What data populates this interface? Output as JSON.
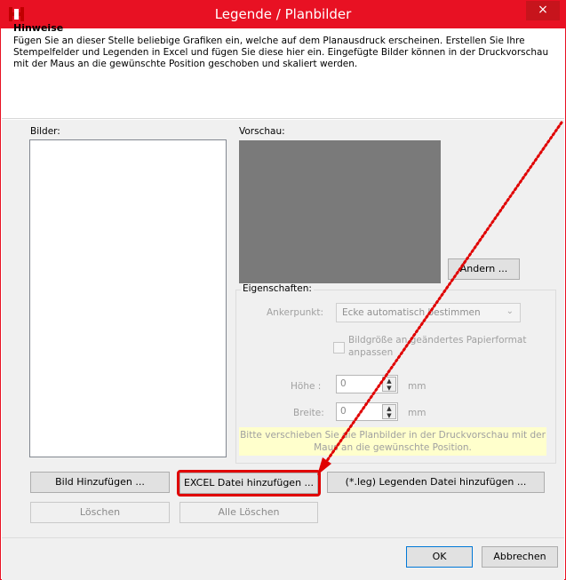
{
  "window": {
    "title": "Legende / Planbilder",
    "close_glyph": "×",
    "accent": "#e81123"
  },
  "hints": {
    "title": "Hinweise",
    "text": "Fügen Sie an dieser Stelle beliebige Grafiken ein, welche auf dem Planausdruck erscheinen.  Erstellen Sie Ihre Stempelfelder und Legenden in Excel und fügen Sie diese hier ein.  Eingefügte Bilder können in der Druckvorschau mit der Maus an die gewünschte Position geschoben und skaliert werden."
  },
  "images": {
    "label": "Bilder:",
    "items": []
  },
  "preview": {
    "label": "Vorschau:",
    "change_button": "Ändern ..."
  },
  "properties": {
    "title": "Eigenschaften:",
    "anchor_label": "Ankerpunkt:",
    "anchor_value": "Ecke automatisch bestimmen",
    "resize_label": "Bildgröße an geändertes Papierformat anpassen",
    "resize_checked": false,
    "height_label": "Höhe :",
    "height_value": "0",
    "width_label": "Breite:",
    "width_value": "0",
    "unit": "mm",
    "info": "Bitte verschieben Sie die Planbilder in der Druckvorschau mit der Maus an die gewünschte Position."
  },
  "buttons": {
    "add_image": "Bild Hinzufügen ...",
    "add_excel": "EXCEL Datei hinzufügen ...",
    "add_legend": "(*.leg)  Legenden Datei hinzufügen ...",
    "delete": "Löschen",
    "delete_all": "Alle Löschen",
    "ok": "OK",
    "cancel": "Abbrechen"
  },
  "annotation": {
    "highlighted_button": "add_excel",
    "color": "#e00000"
  }
}
